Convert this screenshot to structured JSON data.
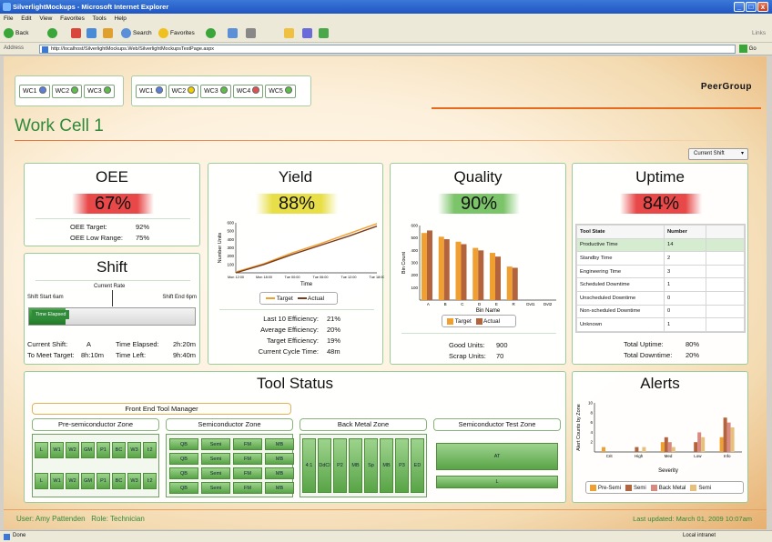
{
  "window": {
    "title": "SilverlightMockups - Microsoft Internet Explorer",
    "min": "_",
    "max": "□",
    "close": "x"
  },
  "menu": [
    "File",
    "Edit",
    "View",
    "Favorites",
    "Tools",
    "Help"
  ],
  "toolbar": {
    "back": "Back",
    "search": "Search",
    "favorites": "Favorites",
    "links": "Links"
  },
  "address": {
    "label": "Address",
    "url": "http://localhost/SilverlightMockups.Web/SilverlightMockupsTestPage.aspx",
    "go": "Go"
  },
  "workcells_a": [
    {
      "label": "WC1",
      "color": "#5b7fd8"
    },
    {
      "label": "WC2",
      "color": "#5cbf4a"
    },
    {
      "label": "WC3",
      "color": "#5cbf4a"
    }
  ],
  "workcells_b": [
    {
      "label": "WC1",
      "color": "#5b7fd8"
    },
    {
      "label": "WC2",
      "color": "#f0d000"
    },
    {
      "label": "WC3",
      "color": "#5cbf4a"
    },
    {
      "label": "WC4",
      "color": "#e05050"
    },
    {
      "label": "WC5",
      "color": "#5cbf4a"
    }
  ],
  "brand": "PeerGroup",
  "page_title": "Work Cell 1",
  "shift_select": "Current Shift",
  "oee": {
    "title": "OEE",
    "value": "67%",
    "bar_color": "#e84848",
    "target_label": "OEE Target:",
    "target": "92%",
    "low_label": "OEE Low Range:",
    "low": "75%"
  },
  "shift": {
    "title": "Shift",
    "current_rate": "Current Rate",
    "start": "Shift Start 6am",
    "end": "Shift End 6pm",
    "elapsed_tag": "Time Elapsed",
    "progress": 0.22,
    "current_shift_label": "Current Shift:",
    "current_shift": "A",
    "time_elapsed_label": "Time Elapsed:",
    "time_elapsed": "2h:20m",
    "to_meet_label": "To Meet Target:",
    "to_meet": "8h:10m",
    "time_left_label": "Time Left:",
    "time_left": "9h:40m"
  },
  "yield": {
    "title": "Yield",
    "value": "88%",
    "bar_color": "#e8df48",
    "ylabel": "Number Units",
    "xlabel": "Time",
    "legend_target": "Target",
    "legend_actual": "Actual",
    "stats": [
      {
        "label": "Last 10 Efficiency:",
        "value": "21%"
      },
      {
        "label": "Average Efficiency:",
        "value": "20%"
      },
      {
        "label": "Target Efficiency:",
        "value": "19%"
      },
      {
        "label": "Current Cycle Time:",
        "value": "48m"
      }
    ]
  },
  "quality": {
    "title": "Quality",
    "value": "90%",
    "bar_color": "#7cc46a",
    "ylabel": "Bin Count",
    "xlabel": "Bin Name",
    "legend_target": "Target",
    "legend_actual": "Actual",
    "good_label": "Good Units:",
    "good": "900",
    "scrap_label": "Scrap Units:",
    "scrap": "70"
  },
  "uptime": {
    "title": "Uptime",
    "value": "84%",
    "bar_color": "#e84848",
    "col_state": "Tool State",
    "col_number": "Number",
    "rows": [
      {
        "state": "Productive Time",
        "number": "14"
      },
      {
        "state": "Standby Time",
        "number": "2"
      },
      {
        "state": "Engineering Time",
        "number": "3"
      },
      {
        "state": "Scheduled Downtime",
        "number": "1"
      },
      {
        "state": "Unscheduled Downtime",
        "number": "0"
      },
      {
        "state": "Non-scheduled Downtime",
        "number": "0"
      },
      {
        "state": "Unknown",
        "number": "1"
      }
    ],
    "total_up_label": "Total Uptime:",
    "total_up": "80%",
    "total_down_label": "Total Downtime:",
    "total_down": "20%"
  },
  "tool_status": {
    "title": "Tool Status",
    "manager": "Front End Tool Manager",
    "zones": [
      "Pre-semiconductor Zone",
      "Semiconductor Zone",
      "Back Metal Zone",
      "Semiconductor Test Zone"
    ],
    "pre_row": [
      "L",
      "W1",
      "W2",
      "GM",
      "P1",
      "BC",
      "W3",
      "I:2"
    ],
    "semi_rows": [
      [
        "QB",
        "Semi",
        "FM",
        "MB"
      ],
      [
        "QB",
        "Semi",
        "FM",
        "MB"
      ],
      [
        "QB",
        "Semi",
        "FM",
        "MB"
      ],
      [
        "QB",
        "Semi",
        "FM",
        "MB"
      ]
    ],
    "back_metal": [
      "4:1",
      "DdCl",
      "P2",
      "MB",
      "Sp",
      "MB",
      "P3",
      "ED"
    ],
    "test": [
      "AT",
      "L"
    ]
  },
  "alerts": {
    "title": "Alerts",
    "ylabel": "Alert Counts by Zone",
    "xlabel": "Severity",
    "legend": [
      "Pre-Semi",
      "Semi",
      "Back Metal",
      "Semi"
    ]
  },
  "footer": {
    "user": "User: Amy Pattenden   Role: Technician",
    "updated": "Last updated: March 01, 2009 10:07am"
  },
  "status": {
    "left": "Done",
    "right": "Local intranet"
  },
  "colors": {
    "orange": "#f0a030",
    "brown": "#b4643c",
    "pink": "#d98a80",
    "olive": "#e7c07c",
    "green": "#2f8a3a"
  },
  "chart_data": [
    {
      "type": "line",
      "title": "",
      "xlabel": "Time",
      "ylabel": "Number Units",
      "x": [
        "Mon 12:00",
        "Mon 18:00",
        "Tue 00:00",
        "Tue 06:00",
        "Tue 12:00",
        "Tue 18:00"
      ],
      "ylim": [
        0,
        600
      ],
      "yticks": [
        100,
        200,
        300,
        400,
        500,
        600
      ],
      "series": [
        {
          "name": "Target",
          "values": [
            10,
            110,
            240,
            350,
            470,
            590
          ]
        },
        {
          "name": "Actual",
          "values": [
            0,
            100,
            220,
            330,
            440,
            560
          ]
        }
      ]
    },
    {
      "type": "bar",
      "title": "",
      "xlabel": "Bin Name",
      "ylabel": "Bin Count",
      "categories": [
        "A",
        "B",
        "C",
        "D",
        "E",
        "R",
        "Dvt1",
        "Dvt2"
      ],
      "ylim": [
        0,
        600
      ],
      "yticks": [
        100,
        200,
        300,
        400,
        500,
        600
      ],
      "series": [
        {
          "name": "Target",
          "values": [
            540,
            510,
            470,
            420,
            380,
            270,
            0,
            0
          ]
        },
        {
          "name": "Actual",
          "values": [
            560,
            490,
            450,
            400,
            350,
            260,
            0,
            0
          ]
        }
      ]
    },
    {
      "type": "bar",
      "title": "",
      "xlabel": "Severity",
      "ylabel": "Alert Counts by Zone",
      "categories": [
        "Crit",
        "High",
        "Med",
        "Low",
        "Info"
      ],
      "ylim": [
        0,
        10
      ],
      "yticks": [
        2,
        4,
        6,
        8,
        10
      ],
      "series": [
        {
          "name": "Pre-Semi",
          "values": [
            1,
            0,
            2,
            0,
            3
          ]
        },
        {
          "name": "Semi",
          "values": [
            0,
            1,
            3,
            2,
            7
          ]
        },
        {
          "name": "Back Metal",
          "values": [
            0,
            0,
            2,
            4,
            6
          ]
        },
        {
          "name": "Semi",
          "values": [
            0,
            1,
            1,
            3,
            5
          ]
        }
      ]
    }
  ]
}
